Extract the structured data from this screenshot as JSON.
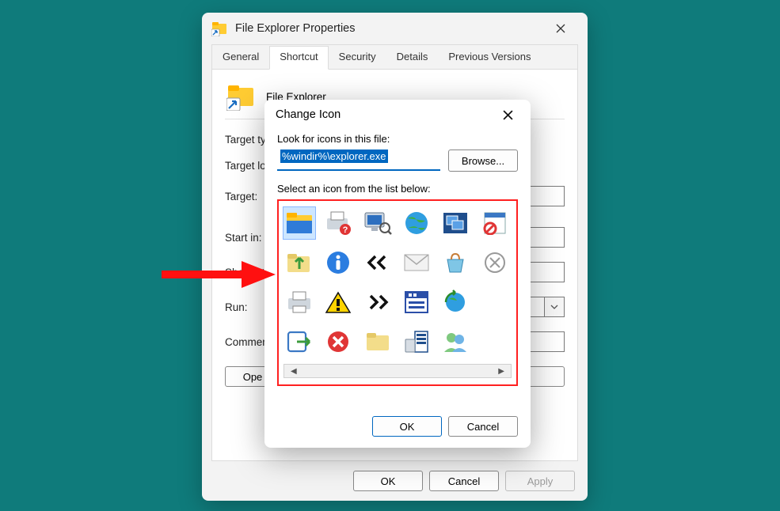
{
  "props": {
    "title": "File Explorer Properties",
    "tabs": {
      "general": "General",
      "shortcut": "Shortcut",
      "security": "Security",
      "details": "Details",
      "previous": "Previous Versions"
    },
    "header_name": "File Explorer",
    "labels": {
      "target_type": "Target ty",
      "target_loc": "Target lo",
      "target": "Target:",
      "start_in": "Start in:",
      "shortcut": "Shortcut",
      "run": "Run:",
      "comment": "Commen"
    },
    "open_file": "Ope",
    "trail_btn": "...",
    "footer": {
      "ok": "OK",
      "cancel": "Cancel",
      "apply": "Apply"
    }
  },
  "ci": {
    "title": "Change Icon",
    "look_label": "Look for icons in this file:",
    "path_value": "%windir%\\explorer.exe",
    "browse": "Browse...",
    "select_label": "Select an icon from the list below:",
    "ok": "OK",
    "cancel": "Cancel",
    "icons": [
      "folder-open",
      "printer-question",
      "computer-search",
      "globe",
      "windows-stack",
      "page-blocked",
      "folder-up",
      "info",
      "chevrons-left",
      "envelope",
      "shopping-bag",
      "cancel-circle",
      "printer",
      "warning",
      "chevrons-right",
      "app-window",
      "globe-refresh",
      "",
      "logoff",
      "error",
      "folder",
      "server-list",
      "users",
      ""
    ]
  }
}
